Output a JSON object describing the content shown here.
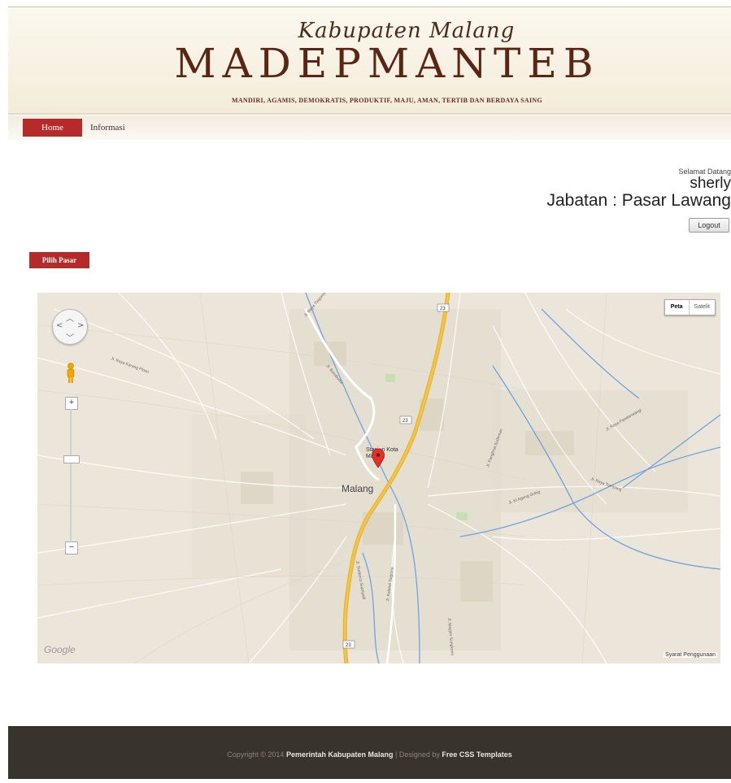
{
  "header": {
    "script_title": "Kabupaten Malang",
    "main_title": "MADEPMANTEB",
    "tagline": "MANDIRI, AGAMIS, DEMOKRATIS, PRODUKTIF, MAJU, AMAN, TERTIB DAN BERDAYA SAING"
  },
  "nav": {
    "items": [
      {
        "label": "Home",
        "active": true
      },
      {
        "label": "Informasi",
        "active": false
      }
    ]
  },
  "welcome": {
    "greeting": "Selamat Datang",
    "user": "sherly",
    "role": "Jabatan : Pasar Lawang",
    "logout_label": "Logout"
  },
  "pilih_pasar_label": "Pilih Pasar",
  "map": {
    "city_label": "Malang",
    "poi_label": "Stasiun Kota Malang",
    "type_buttons": [
      "Peta",
      "Satelit"
    ],
    "terms": "Syarat Penggunaan",
    "watermark": "Google",
    "zoom_in": "+",
    "zoom_out": "−",
    "street_labels": [
      "Jl. Raya Karang Ploso",
      "Jl. Raya Tlogomas",
      "Jl. Borobudur",
      "Jl. Sudanco Supriyadi",
      "Jl. Kolonel Sugiono",
      "Jl. Raya Pandanwangi",
      "Jl. Ki Ageng Gribig",
      "Jl. Mayjen Sungkono",
      "Jl. Raya Tumpang",
      "Jl. Panglima Sudirman"
    ],
    "route_labels": [
      "23",
      "23",
      "23"
    ]
  },
  "footer": {
    "copyright": "Copyright © 2014",
    "org": "Pemerintah Kabupaten Malang",
    "sep": "| Designed by",
    "designer": "Free CSS Templates"
  },
  "colors": {
    "accent_red": "#b52b2b",
    "logo_brown": "#5b2514",
    "footer_bg": "#38332d",
    "map_road_yellow": "#f4c542",
    "map_water": "#6fa3e0"
  }
}
